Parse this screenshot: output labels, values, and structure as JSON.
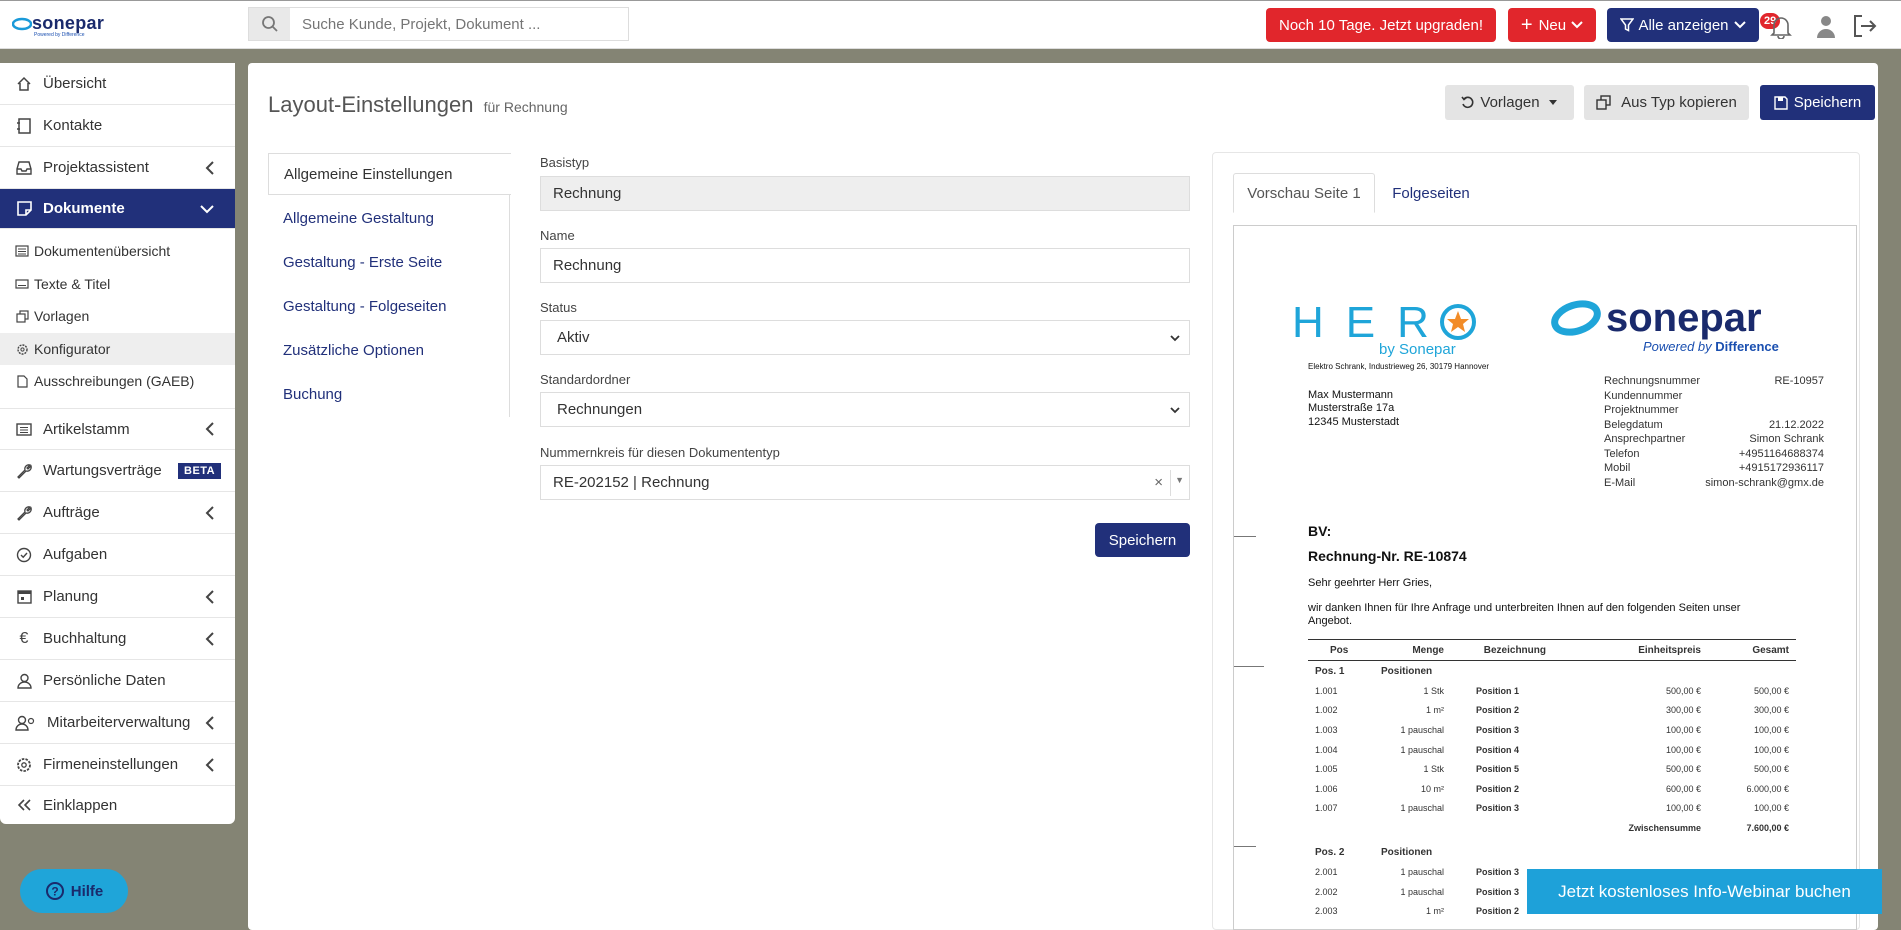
{
  "topbar": {
    "logo_text": "sonepar",
    "logo_sub": "Powered by Difference",
    "search_placeholder": "Suche Kunde, Projekt, Dokument ...",
    "upgrade_label": "Noch 10 Tage. Jetzt upgraden!",
    "new_label": "Neu",
    "filter_label": "Alle anzeigen",
    "notification_count": "29"
  },
  "sidebar": {
    "items": [
      {
        "label": "Übersicht",
        "icon": "home-icon"
      },
      {
        "label": "Kontakte",
        "icon": "contacts-icon"
      },
      {
        "label": "Projektassistent",
        "icon": "inbox-icon"
      },
      {
        "label": "Dokumente",
        "icon": "document-icon"
      },
      {
        "label": "Dokumentenübersicht",
        "icon": "list-icon"
      },
      {
        "label": "Texte & Titel",
        "icon": "keyboard-icon"
      },
      {
        "label": "Vorlagen",
        "icon": "copy-icon"
      },
      {
        "label": "Konfigurator",
        "icon": "gear-icon"
      },
      {
        "label": "Ausschreibungen (GAEB)",
        "icon": "file-icon"
      },
      {
        "label": "Artikelstamm",
        "icon": "list-icon"
      },
      {
        "label": "Wartungsverträge",
        "icon": "wrench-icon",
        "badge": "BETA"
      },
      {
        "label": "Aufträge",
        "icon": "wrench-icon"
      },
      {
        "label": "Aufgaben",
        "icon": "check-circle-icon"
      },
      {
        "label": "Planung",
        "icon": "calendar-icon"
      },
      {
        "label": "Buchhaltung",
        "icon": "euro-icon"
      },
      {
        "label": "Persönliche Daten",
        "icon": "user-icon"
      },
      {
        "label": "Mitarbeiterverwaltung",
        "icon": "users-icon"
      },
      {
        "label": "Firmeneinstellungen",
        "icon": "gear-icon"
      },
      {
        "label": "Einklappen",
        "icon": "double-chevron-left-icon"
      }
    ],
    "help_label": "Hilfe"
  },
  "header": {
    "title": "Layout-Einstellungen",
    "subtitle": "für Rechnung",
    "templates_label": "Vorlagen",
    "copy_label": "Aus Typ kopieren",
    "save_label": "Speichern"
  },
  "settings_tabs": [
    "Allgemeine Einstellungen",
    "Allgemeine Gestaltung",
    "Gestaltung - Erste Seite",
    "Gestaltung - Folgeseiten",
    "Zusätzliche Optionen",
    "Buchung"
  ],
  "form": {
    "basistyp_label": "Basistyp",
    "basistyp_value": "Rechnung",
    "name_label": "Name",
    "name_value": "Rechnung",
    "status_label": "Status",
    "status_value": "Aktiv",
    "folder_label": "Standardordner",
    "folder_value": "Rechnungen",
    "number_label": "Nummernkreis für diesen Dokumententyp",
    "number_value": "RE-202152 | Rechnung",
    "save_label": "Speichern"
  },
  "preview": {
    "tabs": [
      "Vorschau Seite 1",
      "Folgeseiten"
    ],
    "hero_text": "HER",
    "hero_sub": "by Sonepar",
    "brand": "sonepar",
    "brand_sub_1": "Powered by",
    "brand_sub_2": "Difference",
    "sender_line": "Elektro Schrank, Industrieweg 26, 30179 Hannover",
    "recipient": [
      "Max Mustermann",
      "Musterstraße 17a",
      "12345 Musterstadt"
    ],
    "meta": [
      {
        "k": "Rechnungsnummer",
        "v": "RE-10957"
      },
      {
        "k": "Kundennummer",
        "v": ""
      },
      {
        "k": "Projektnummer",
        "v": ""
      },
      {
        "k": "Belegdatum",
        "v": "21.12.2022"
      },
      {
        "k": "Ansprechpartner",
        "v": "Simon Schrank"
      },
      {
        "k": "Telefon",
        "v": "+4951164688374"
      },
      {
        "k": "Mobil",
        "v": "+4915172936117"
      },
      {
        "k": "E-Mail",
        "v": "simon-schrank@gmx.de"
      }
    ],
    "bv": "BV:",
    "doc_title": "Rechnung-Nr. RE-10874",
    "salutation": "Sehr geehrter Herr Gries,",
    "intro_1": "wir danken Ihnen für Ihre Anfrage und unterbreiten Ihnen auf den folgenden Seiten unser",
    "intro_2": "Angebot.",
    "columns": [
      "Pos",
      "Menge",
      "Bezeichnung",
      "Einheitspreis",
      "Gesamt"
    ],
    "group1": {
      "pos": "Pos. 1",
      "label": "Positionen"
    },
    "rows1": [
      [
        "1.001",
        "1 Stk",
        "Position 1",
        "500,00 €",
        "500,00 €"
      ],
      [
        "1.002",
        "1 m²",
        "Position 2",
        "300,00 €",
        "300,00 €"
      ],
      [
        "1.003",
        "1 pauschal",
        "Position 3",
        "100,00 €",
        "100,00 €"
      ],
      [
        "1.004",
        "1 pauschal",
        "Position 4",
        "100,00 €",
        "100,00 €"
      ],
      [
        "1.005",
        "1 Stk",
        "Position 5",
        "500,00 €",
        "500,00 €"
      ],
      [
        "1.006",
        "10 m²",
        "Position 2",
        "600,00 €",
        "6.000,00 €"
      ],
      [
        "1.007",
        "1 pauschal",
        "Position 3",
        "100,00 €",
        "100,00 €"
      ]
    ],
    "subtotal_label": "Zwischensumme",
    "subtotal1": "7.600,00 €",
    "group2": {
      "pos": "Pos. 2",
      "label": "Positionen"
    },
    "rows2": [
      [
        "2.001",
        "1 pauschal",
        "Position 3"
      ],
      [
        "2.002",
        "1 pauschal",
        "Position 3"
      ],
      [
        "2.003",
        "1 m²",
        "Position 2"
      ]
    ]
  },
  "webinar_label": "Jetzt kostenloses Info-Webinar buchen",
  "colors": {
    "primary": "#21307a",
    "danger": "#e1262c",
    "info": "#1ea1d9"
  }
}
